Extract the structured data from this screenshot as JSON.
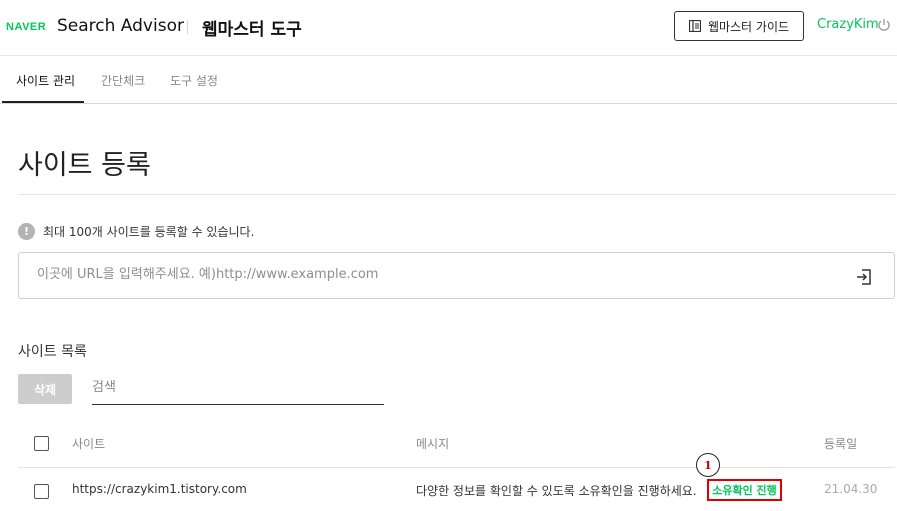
{
  "header": {
    "naver_logo": "NAVER",
    "brand": "Search Advisor",
    "app_title": "웹마스터 도구",
    "guide_button": "웹마스터 가이드",
    "username": "CrazyKim"
  },
  "tabs": [
    {
      "label": "사이트 관리",
      "active": true
    },
    {
      "label": "간단체크",
      "active": false
    },
    {
      "label": "도구 설정",
      "active": false
    }
  ],
  "page": {
    "title": "사이트 등록",
    "notice": "최대 100개 사이트를 등록할 수 있습니다.",
    "url_placeholder": "이곳에 URL을 입력해주세요. 예)http://www.example.com"
  },
  "site_list": {
    "title": "사이트 목록",
    "delete_button": "삭제",
    "search_placeholder": "검색",
    "columns": {
      "site": "사이트",
      "message": "메시지",
      "date": "등록일"
    },
    "rows": [
      {
        "site": "https://crazykim1.tistory.com",
        "message": "다양한 정보를 확인할 수 있도록 소유확인을 진행하세요.",
        "action": "소유확인 진행",
        "date": "21.04.30"
      }
    ]
  },
  "annotation": {
    "number": "1"
  },
  "colors": {
    "brand_green": "#03c75a",
    "highlight_red": "#e00000"
  }
}
